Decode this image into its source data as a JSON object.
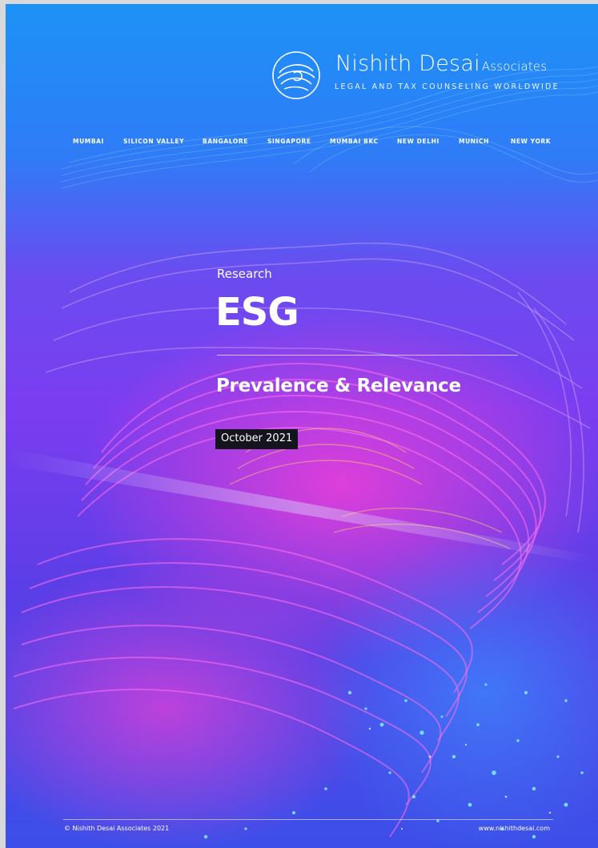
{
  "brand": {
    "name": "Nishith Desai",
    "name_suffix": "Associates",
    "tagline": "LEGAL AND TAX COUNSELING WORLDWIDE",
    "logo_icon": "nda-swirl-logo"
  },
  "nav": {
    "offices": [
      "MUMBAI",
      "SILICON VALLEY",
      "BANGALORE",
      "SINGAPORE",
      "MUMBAI BKC",
      "NEW DELHI",
      "MUNICH",
      "NEW YORK"
    ]
  },
  "cover": {
    "kicker": "Research",
    "title": "ESG",
    "subtitle": "Prevalence & Relevance",
    "date": "October 2021"
  },
  "footer": {
    "copyright": "© Nishith Desai Associates 2021",
    "website": "www.nishithdesai.com"
  },
  "colors": {
    "top": "#1c92f6",
    "middle": "#7b3df0",
    "bottom": "#3c4fe8",
    "magenta_accent": "#e23cd8",
    "cyan_accent": "#5ef0ff",
    "date_box": "#14141e"
  }
}
